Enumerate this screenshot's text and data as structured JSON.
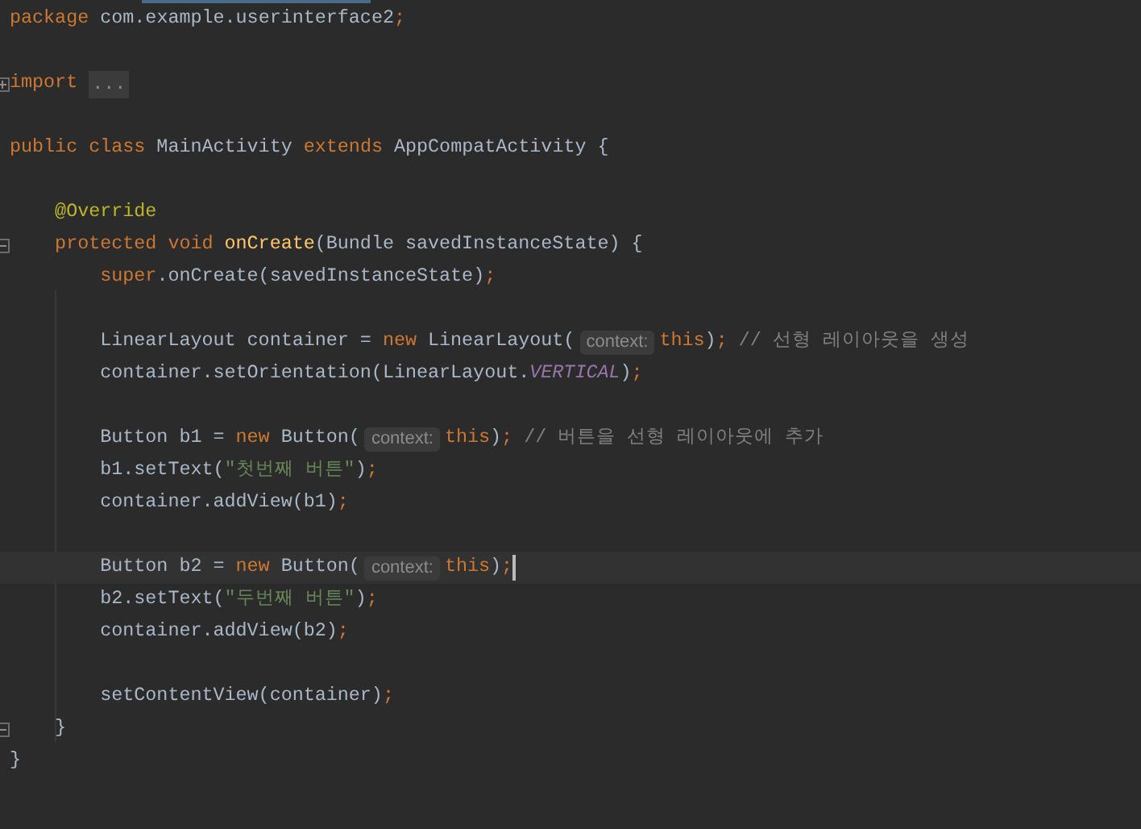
{
  "editor": {
    "lines": [
      {
        "kind": "code",
        "tokens": [
          {
            "text": "package",
            "kind": "keyword"
          },
          {
            "text": " com.example.userinterface2",
            "kind": "plain"
          },
          {
            "text": ";",
            "kind": "keyword"
          }
        ]
      },
      {
        "kind": "blank"
      },
      {
        "kind": "code",
        "collapsed": true,
        "tokens": [
          {
            "text": "import ",
            "kind": "keyword"
          },
          {
            "text": "...",
            "kind": "fold"
          }
        ]
      },
      {
        "kind": "blank"
      },
      {
        "kind": "code",
        "tokens": [
          {
            "text": "public class",
            "kind": "keyword"
          },
          {
            "text": " MainActivity ",
            "kind": "plain"
          },
          {
            "text": "extends",
            "kind": "keyword"
          },
          {
            "text": " AppCompatActivity {",
            "kind": "plain"
          }
        ]
      },
      {
        "kind": "blank"
      },
      {
        "kind": "code",
        "tokens": [
          {
            "text": "    @Override",
            "kind": "annotation"
          }
        ]
      },
      {
        "kind": "code",
        "collapsed": false,
        "tokens": [
          {
            "text": "    protected void ",
            "kind": "keyword"
          },
          {
            "text": "onCreate",
            "kind": "method"
          },
          {
            "text": "(Bundle savedInstanceState) {",
            "kind": "plain"
          }
        ]
      },
      {
        "kind": "code",
        "tokens": [
          {
            "text": "        super",
            "kind": "keyword"
          },
          {
            "text": ".onCreate(savedInstanceState)",
            "kind": "plain"
          },
          {
            "text": ";",
            "kind": "keyword"
          }
        ]
      },
      {
        "kind": "blank"
      },
      {
        "kind": "code",
        "tokens": [
          {
            "text": "        LinearLayout container = ",
            "kind": "plain"
          },
          {
            "text": "new",
            "kind": "keyword"
          },
          {
            "text": " LinearLayout(",
            "kind": "plain"
          },
          {
            "text": "context:",
            "kind": "hint"
          },
          {
            "text": "this",
            "kind": "keyword"
          },
          {
            "text": ")",
            "kind": "plain"
          },
          {
            "text": ";",
            "kind": "keyword"
          },
          {
            "text": " // 선형 레이아웃을 생성",
            "kind": "comment"
          }
        ]
      },
      {
        "kind": "code",
        "tokens": [
          {
            "text": "        container.setOrientation(LinearLayout.",
            "kind": "plain"
          },
          {
            "text": "VERTICAL",
            "kind": "constant"
          },
          {
            "text": ")",
            "kind": "plain"
          },
          {
            "text": ";",
            "kind": "keyword"
          }
        ]
      },
      {
        "kind": "blank"
      },
      {
        "kind": "code",
        "tokens": [
          {
            "text": "        Button b1 = ",
            "kind": "plain"
          },
          {
            "text": "new",
            "kind": "keyword"
          },
          {
            "text": " Button(",
            "kind": "plain"
          },
          {
            "text": "context:",
            "kind": "hint"
          },
          {
            "text": "this",
            "kind": "keyword"
          },
          {
            "text": ")",
            "kind": "plain"
          },
          {
            "text": ";",
            "kind": "keyword"
          },
          {
            "text": " // 버튼을 선형 레이아웃에 추가",
            "kind": "comment"
          }
        ]
      },
      {
        "kind": "code",
        "tokens": [
          {
            "text": "        b1.setText(",
            "kind": "plain"
          },
          {
            "text": "\"첫번째 버튼\"",
            "kind": "string"
          },
          {
            "text": ")",
            "kind": "plain"
          },
          {
            "text": ";",
            "kind": "keyword"
          }
        ]
      },
      {
        "kind": "code",
        "tokens": [
          {
            "text": "        container.addView(b1)",
            "kind": "plain"
          },
          {
            "text": ";",
            "kind": "keyword"
          }
        ]
      },
      {
        "kind": "blank"
      },
      {
        "kind": "code",
        "current": true,
        "tokens": [
          {
            "text": "        Button b2 = ",
            "kind": "plain"
          },
          {
            "text": "new",
            "kind": "keyword"
          },
          {
            "text": " Button(",
            "kind": "plain"
          },
          {
            "text": "context:",
            "kind": "hint"
          },
          {
            "text": "this",
            "kind": "keyword"
          },
          {
            "text": ")",
            "kind": "plain"
          },
          {
            "text": ";",
            "kind": "keyword"
          }
        ]
      },
      {
        "kind": "code",
        "tokens": [
          {
            "text": "        b2.setText(",
            "kind": "plain"
          },
          {
            "text": "\"두번째 버튼\"",
            "kind": "string"
          },
          {
            "text": ")",
            "kind": "plain"
          },
          {
            "text": ";",
            "kind": "keyword"
          }
        ]
      },
      {
        "kind": "code",
        "tokens": [
          {
            "text": "        container.addView(b2)",
            "kind": "plain"
          },
          {
            "text": ";",
            "kind": "keyword"
          }
        ]
      },
      {
        "kind": "blank"
      },
      {
        "kind": "code",
        "tokens": [
          {
            "text": "        setContentView(container)",
            "kind": "plain"
          },
          {
            "text": ";",
            "kind": "keyword"
          }
        ]
      },
      {
        "kind": "code",
        "collapsed": false,
        "tokens": [
          {
            "text": "    }",
            "kind": "plain"
          }
        ]
      },
      {
        "kind": "code",
        "tokens": [
          {
            "text": "}",
            "kind": "plain"
          }
        ]
      }
    ]
  }
}
